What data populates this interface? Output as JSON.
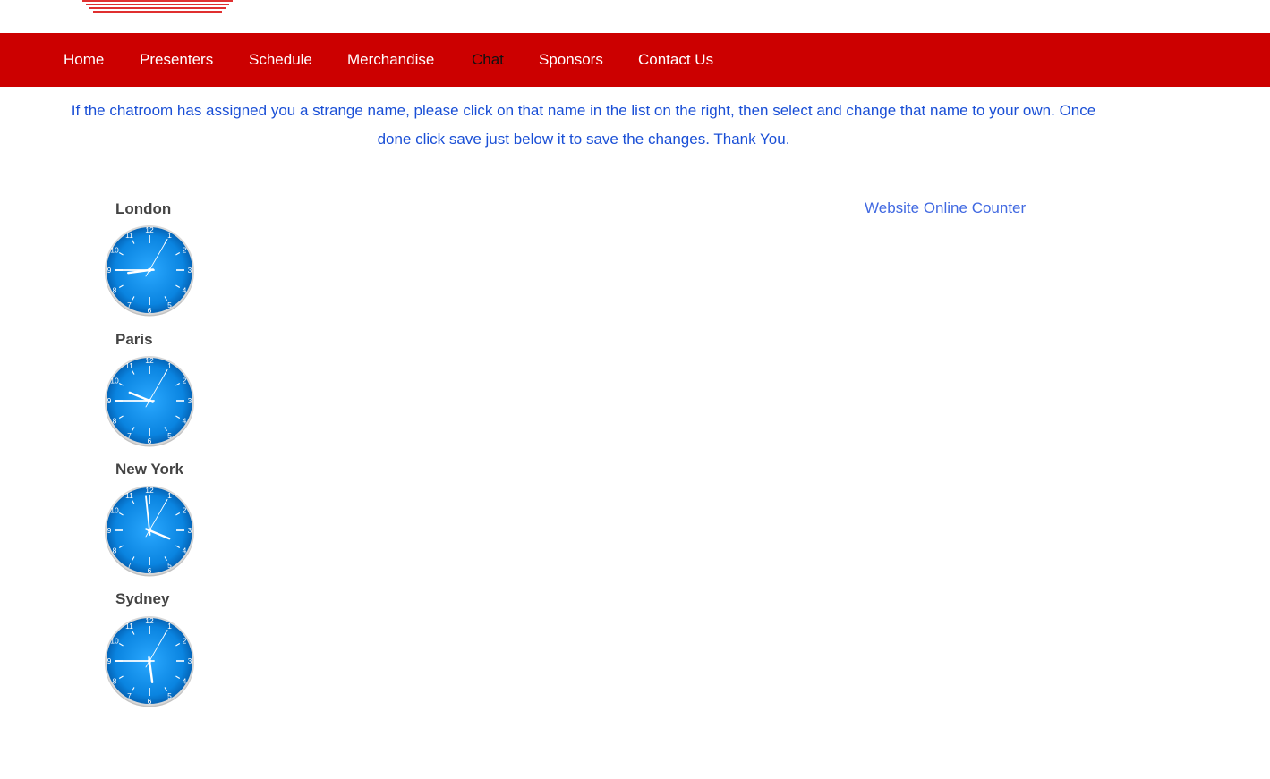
{
  "nav": {
    "items": [
      {
        "label": "Home"
      },
      {
        "label": "Presenters"
      },
      {
        "label": "Schedule"
      },
      {
        "label": "Merchandise"
      },
      {
        "label": "Chat",
        "active": true
      },
      {
        "label": "Sponsors"
      },
      {
        "label": "Contact Us"
      }
    ]
  },
  "notice": {
    "text": "If the chatroom has assigned you a strange name, please click on that name in the list on the right, then select and change that name to your own. Once done click save just below it to save the changes. Thank You."
  },
  "clocks": [
    {
      "city": "London",
      "hour": 8.75,
      "minute": 45,
      "second": 5
    },
    {
      "city": "Paris",
      "hour": 9.75,
      "minute": 45,
      "second": 5
    },
    {
      "city": "New York",
      "hour": 3.75,
      "minute": 59,
      "second": 5
    },
    {
      "city": "Sydney",
      "hour": 17.75,
      "minute": 45,
      "second": 5
    }
  ],
  "clock_numbers": [
    "12",
    "1",
    "2",
    "3",
    "4",
    "5",
    "6",
    "7",
    "8",
    "9",
    "10",
    "11"
  ],
  "counter": {
    "label": "Website Online Counter"
  },
  "colors": {
    "nav_background": "#cc0000",
    "nav_text": "#ffffff",
    "nav_active_text": "#111111",
    "notice_text": "#1a4fd6",
    "counter_link": "#4169e1",
    "clock_face": "#0a84e0"
  }
}
